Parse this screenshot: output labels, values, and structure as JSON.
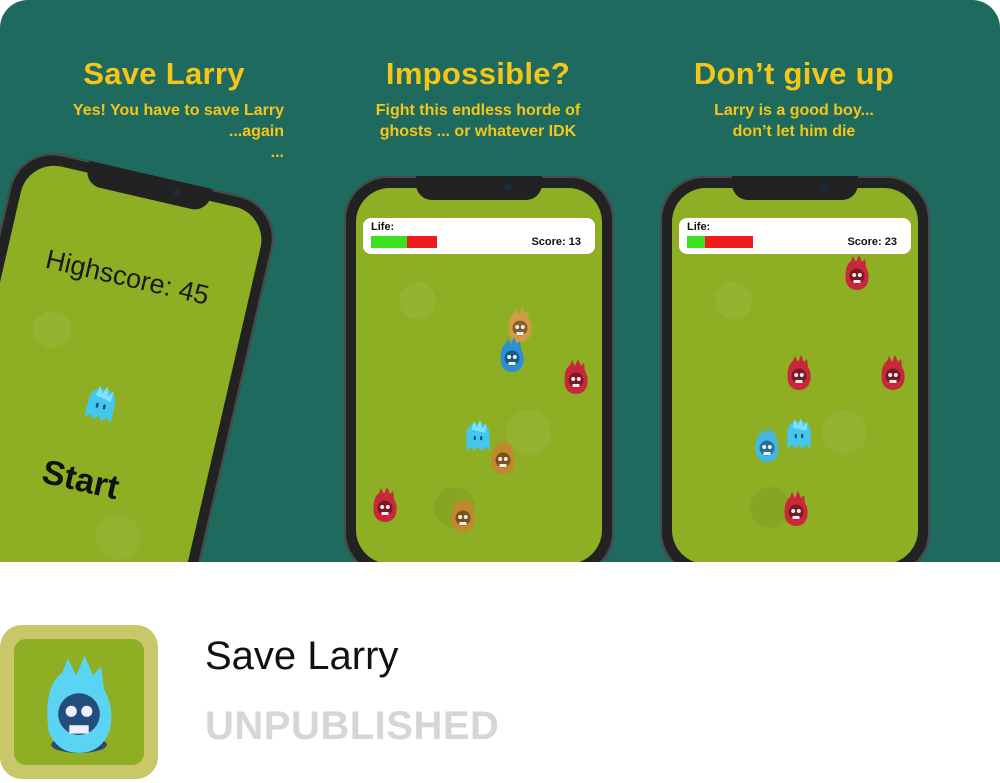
{
  "screenshots": [
    {
      "title": "Save Larry",
      "subtitle_lines": [
        "Yes! You have to save Larry",
        "...again",
        "..."
      ],
      "highscore_label": "Highscore: 45",
      "start_label": "Start"
    },
    {
      "title": "Impossible?",
      "subtitle_lines": [
        "Fight this endless horde of",
        "ghosts ... or whatever IDK"
      ],
      "life_label": "Life:",
      "life_fraction": 0.55,
      "score_label": "Score: 13"
    },
    {
      "title": "Don’t give up",
      "subtitle_lines": [
        "Larry is a good boy...",
        "don’t let him die"
      ],
      "life_label": "Life:",
      "life_fraction": 0.27,
      "score_label": "Score: 23"
    }
  ],
  "app": {
    "name": "Save Larry",
    "status": "UNPUBLISHED",
    "icon": "blue-skull-ghost-icon"
  },
  "colors": {
    "banner_bg": "#1e6a5f",
    "caption": "#f5c518",
    "grass": "#8eae24",
    "life_full": "#3be021",
    "life_empty": "#ee1c1c",
    "status_text": "#d6d6d6"
  },
  "icons": {
    "larry": "blue-ghost-icon",
    "enemy_red": "red-skull-ghost-icon",
    "enemy_brown": "brown-skull-ghost-icon",
    "enemy_blue": "blue-skull-ghost-icon"
  }
}
